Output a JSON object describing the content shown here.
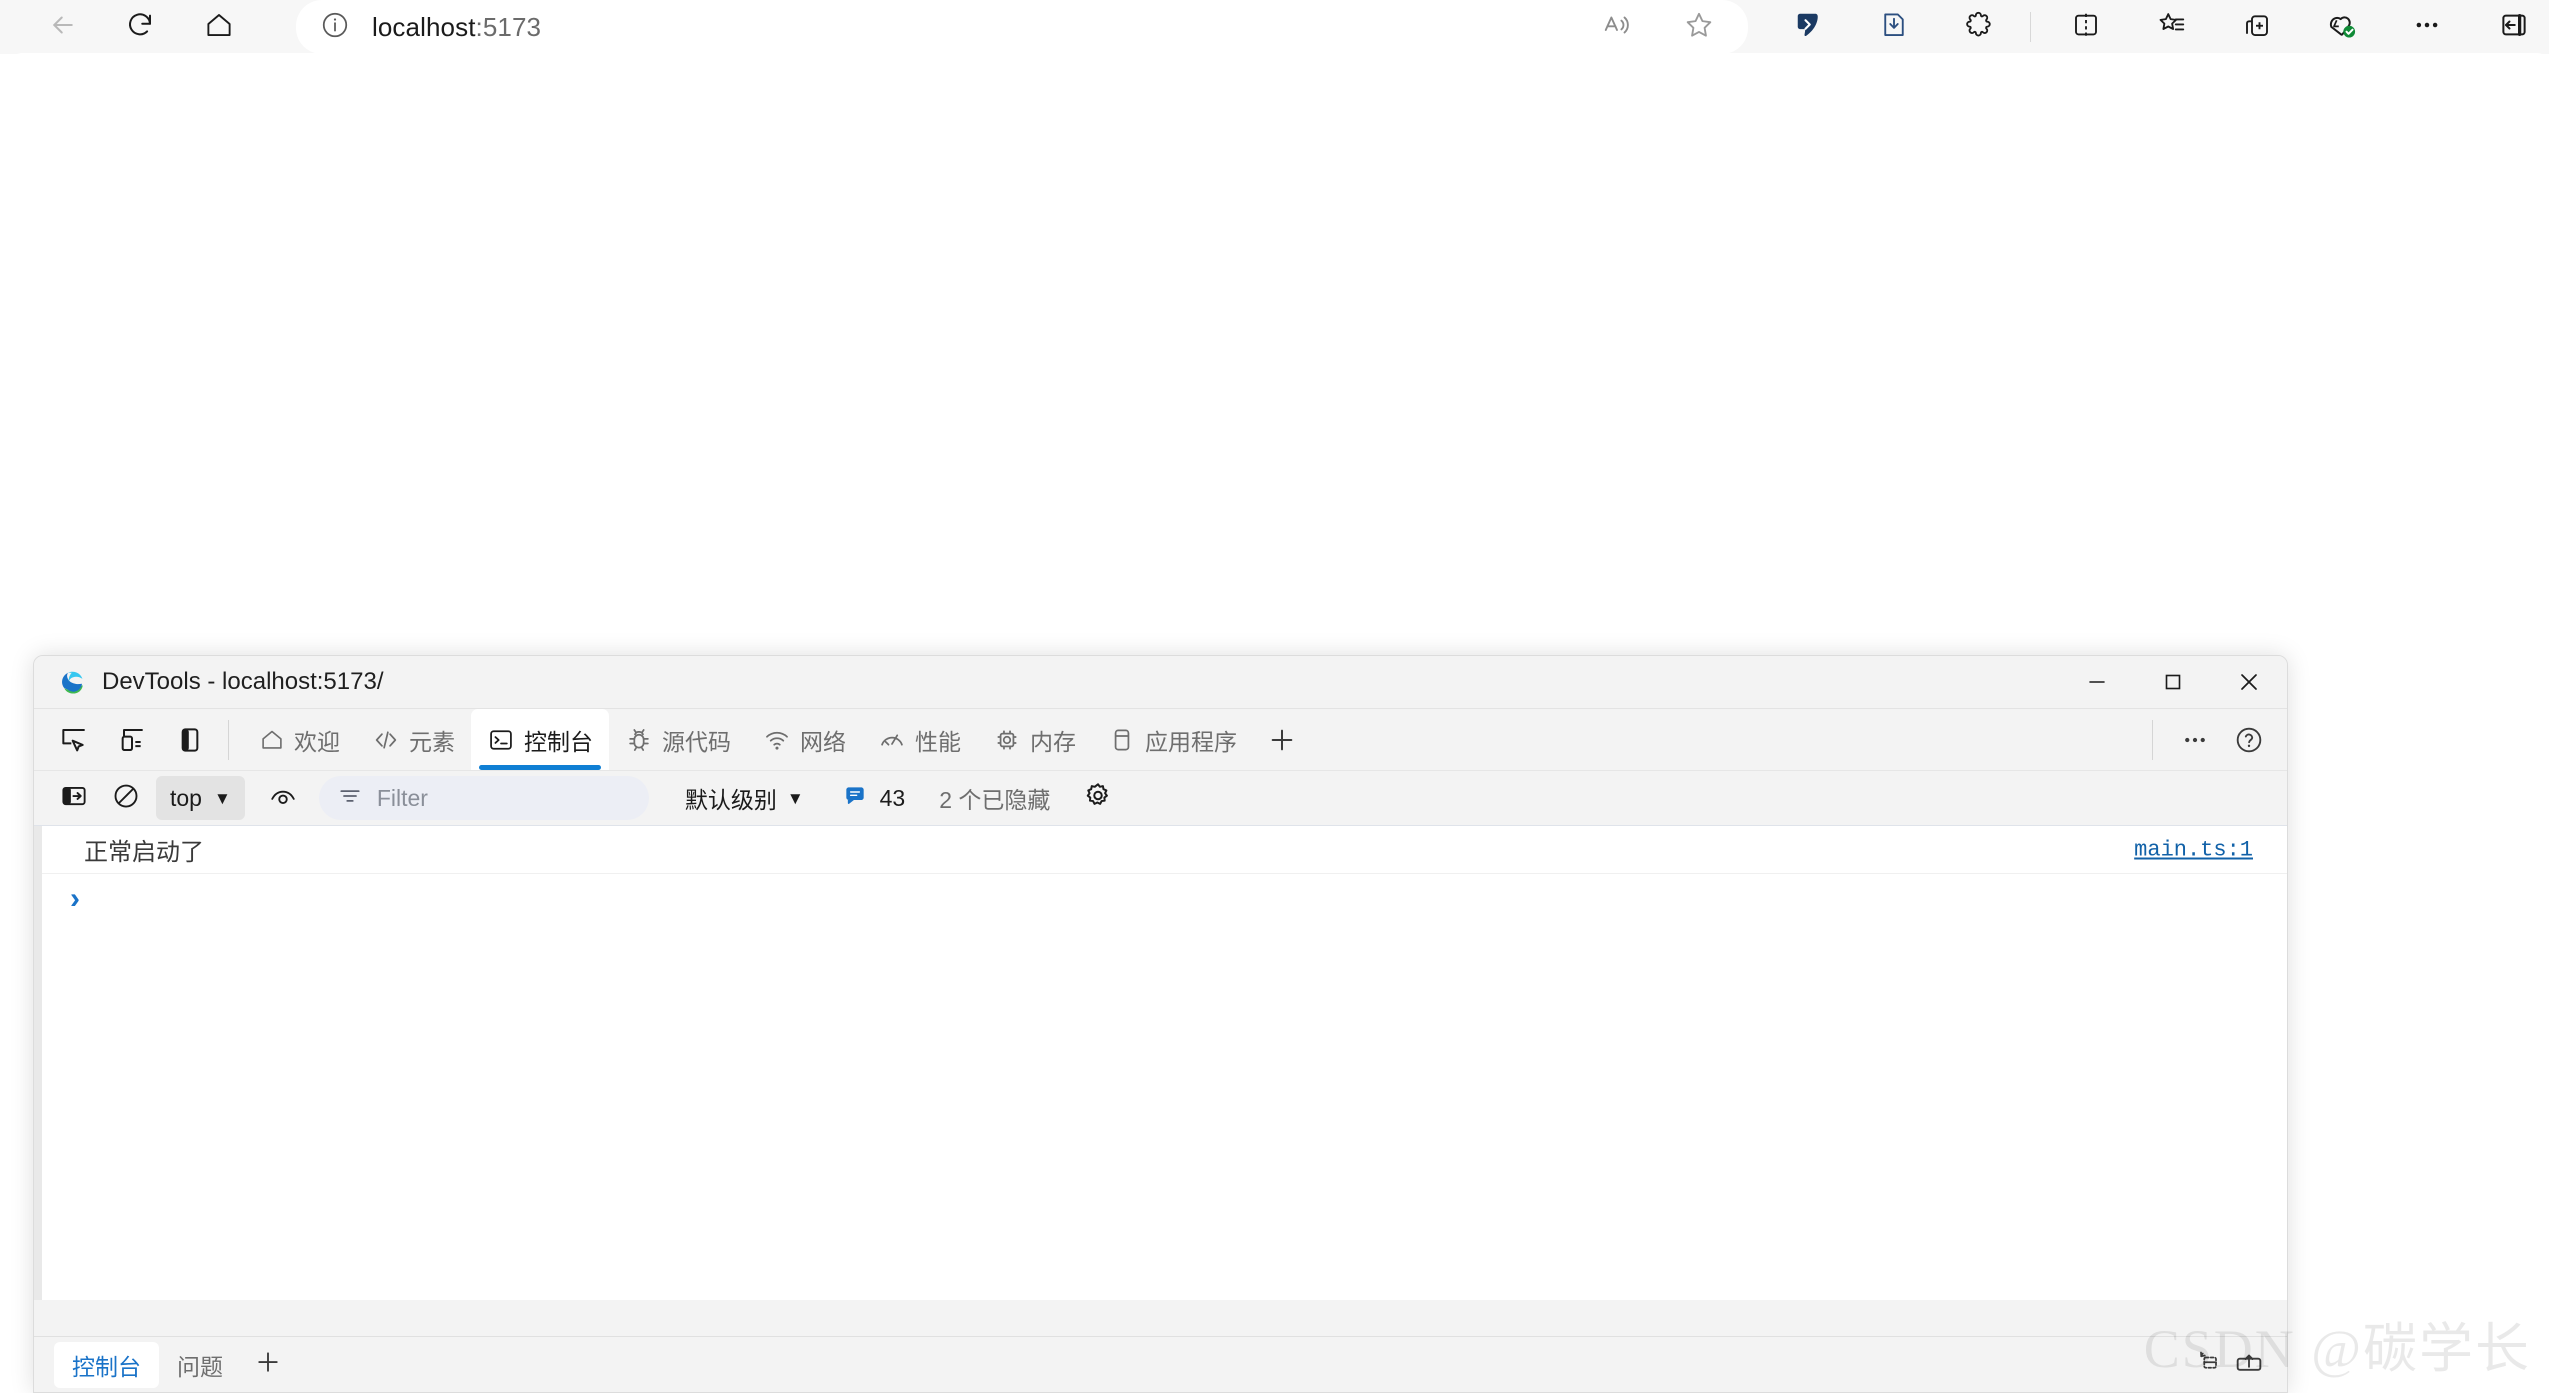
{
  "browser": {
    "nav": {
      "back_icon": "arrow-left-icon",
      "reload_icon": "reload-icon",
      "home_icon": "home-icon"
    },
    "address_bar": {
      "site_info_icon": "info-circle-icon",
      "url_head": "localhost",
      "url_tail": ":5173",
      "full_url": "localhost:5173"
    },
    "toolbar_icons": [
      {
        "name": "read-aloud-icon",
        "label": "Read aloud"
      },
      {
        "name": "favorite-star-icon",
        "label": "Add to favorites"
      },
      {
        "name": "copilot-icon",
        "label": "Copilot"
      },
      {
        "name": "downloads-icon",
        "label": "Downloads"
      },
      {
        "name": "extensions-icon",
        "label": "Extensions"
      },
      {
        "name": "split-screen-icon",
        "label": "Split screen"
      },
      {
        "name": "collections-icon",
        "label": "Collections"
      },
      {
        "name": "browser-essentials-icon",
        "label": "Browser essentials"
      },
      {
        "name": "profile-icon",
        "label": "Profile"
      },
      {
        "name": "settings-and-more-icon",
        "label": "Settings and more"
      },
      {
        "name": "sidebar-toggle-icon",
        "label": "Sidebar"
      }
    ]
  },
  "devtools": {
    "window_title": "DevTools - localhost:5173/",
    "window_controls": {
      "minimize": "—",
      "maximize": "□",
      "close": "✕"
    },
    "tabbar_tools": [
      {
        "name": "inspect-element-icon",
        "label": "检查"
      },
      {
        "name": "device-emulation-icon",
        "label": "设备模拟"
      },
      {
        "name": "dock-side-icon",
        "label": "停靠位置"
      }
    ],
    "tabs": [
      {
        "label": "欢迎",
        "icon": "home-icon",
        "active": false
      },
      {
        "label": "元素",
        "icon": "code-brackets-icon",
        "active": false
      },
      {
        "label": "控制台",
        "icon": "console-icon",
        "active": true
      },
      {
        "label": "源代码",
        "icon": "bug-icon",
        "active": false
      },
      {
        "label": "网络",
        "icon": "wifi-icon",
        "active": false
      },
      {
        "label": "性能",
        "icon": "gauge-icon",
        "active": false
      },
      {
        "label": "内存",
        "icon": "chip-icon",
        "active": false
      },
      {
        "label": "应用程序",
        "icon": "application-icon",
        "active": false
      }
    ],
    "add_tab_icon": "plus-icon",
    "more_options_icon": "ellipsis-icon",
    "help_icon": "help-circle-icon",
    "console_toolbar": {
      "sidebar_toggle_icon": "console-sidebar-icon",
      "clear_console_icon": "clear-console-icon",
      "context_value": "top",
      "context_chevron": "▼",
      "live_expression_icon": "eye-icon",
      "filter_icon": "filter-icon",
      "filter_placeholder": "Filter",
      "filter_value": "",
      "level_value": "默认级别",
      "level_chevron": "▼",
      "info_badge_icon": "message-badge-icon",
      "info_badge_color": "#1a73c8",
      "message_count": "43",
      "hidden_count_text": "2 个已隐藏",
      "settings_icon": "gear-icon"
    },
    "console_messages": [
      {
        "text": "正常启动了",
        "source": "main.ts:1",
        "level": "log"
      }
    ],
    "prompt": {
      "chevron": "›",
      "value": ""
    },
    "drawer_tabs": [
      {
        "label": "控制台",
        "active": true
      },
      {
        "label": "问题",
        "active": false
      }
    ],
    "drawer_add_icon": "plus-icon",
    "drawer_right_icons": [
      {
        "name": "issues-refresh-icon"
      },
      {
        "name": "screenshot-upload-icon"
      }
    ]
  },
  "watermark": {
    "text": "CSDN @碳学长"
  }
}
